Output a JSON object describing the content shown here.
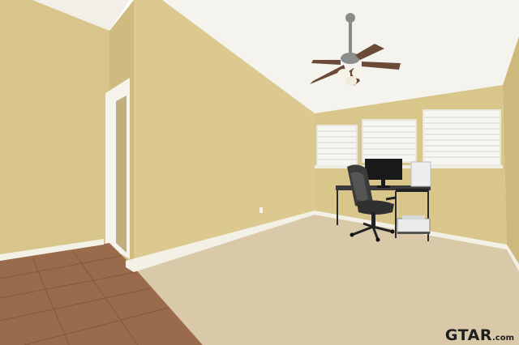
{
  "watermark": {
    "brand": "GTAR",
    "tld": ".com"
  },
  "colors": {
    "wall": "#dcc98f",
    "wall_shadow": "#c9b57c",
    "ceiling": "#f4f3ee",
    "carpet": "#d9c9a8",
    "tile": "#9a6a4c",
    "baseboard": "#f3f0e6"
  },
  "icons": [
    "ceiling-fan-icon",
    "window-blinds-icon",
    "office-chair-icon",
    "monitor-icon",
    "desk-icon",
    "printer-icon"
  ]
}
